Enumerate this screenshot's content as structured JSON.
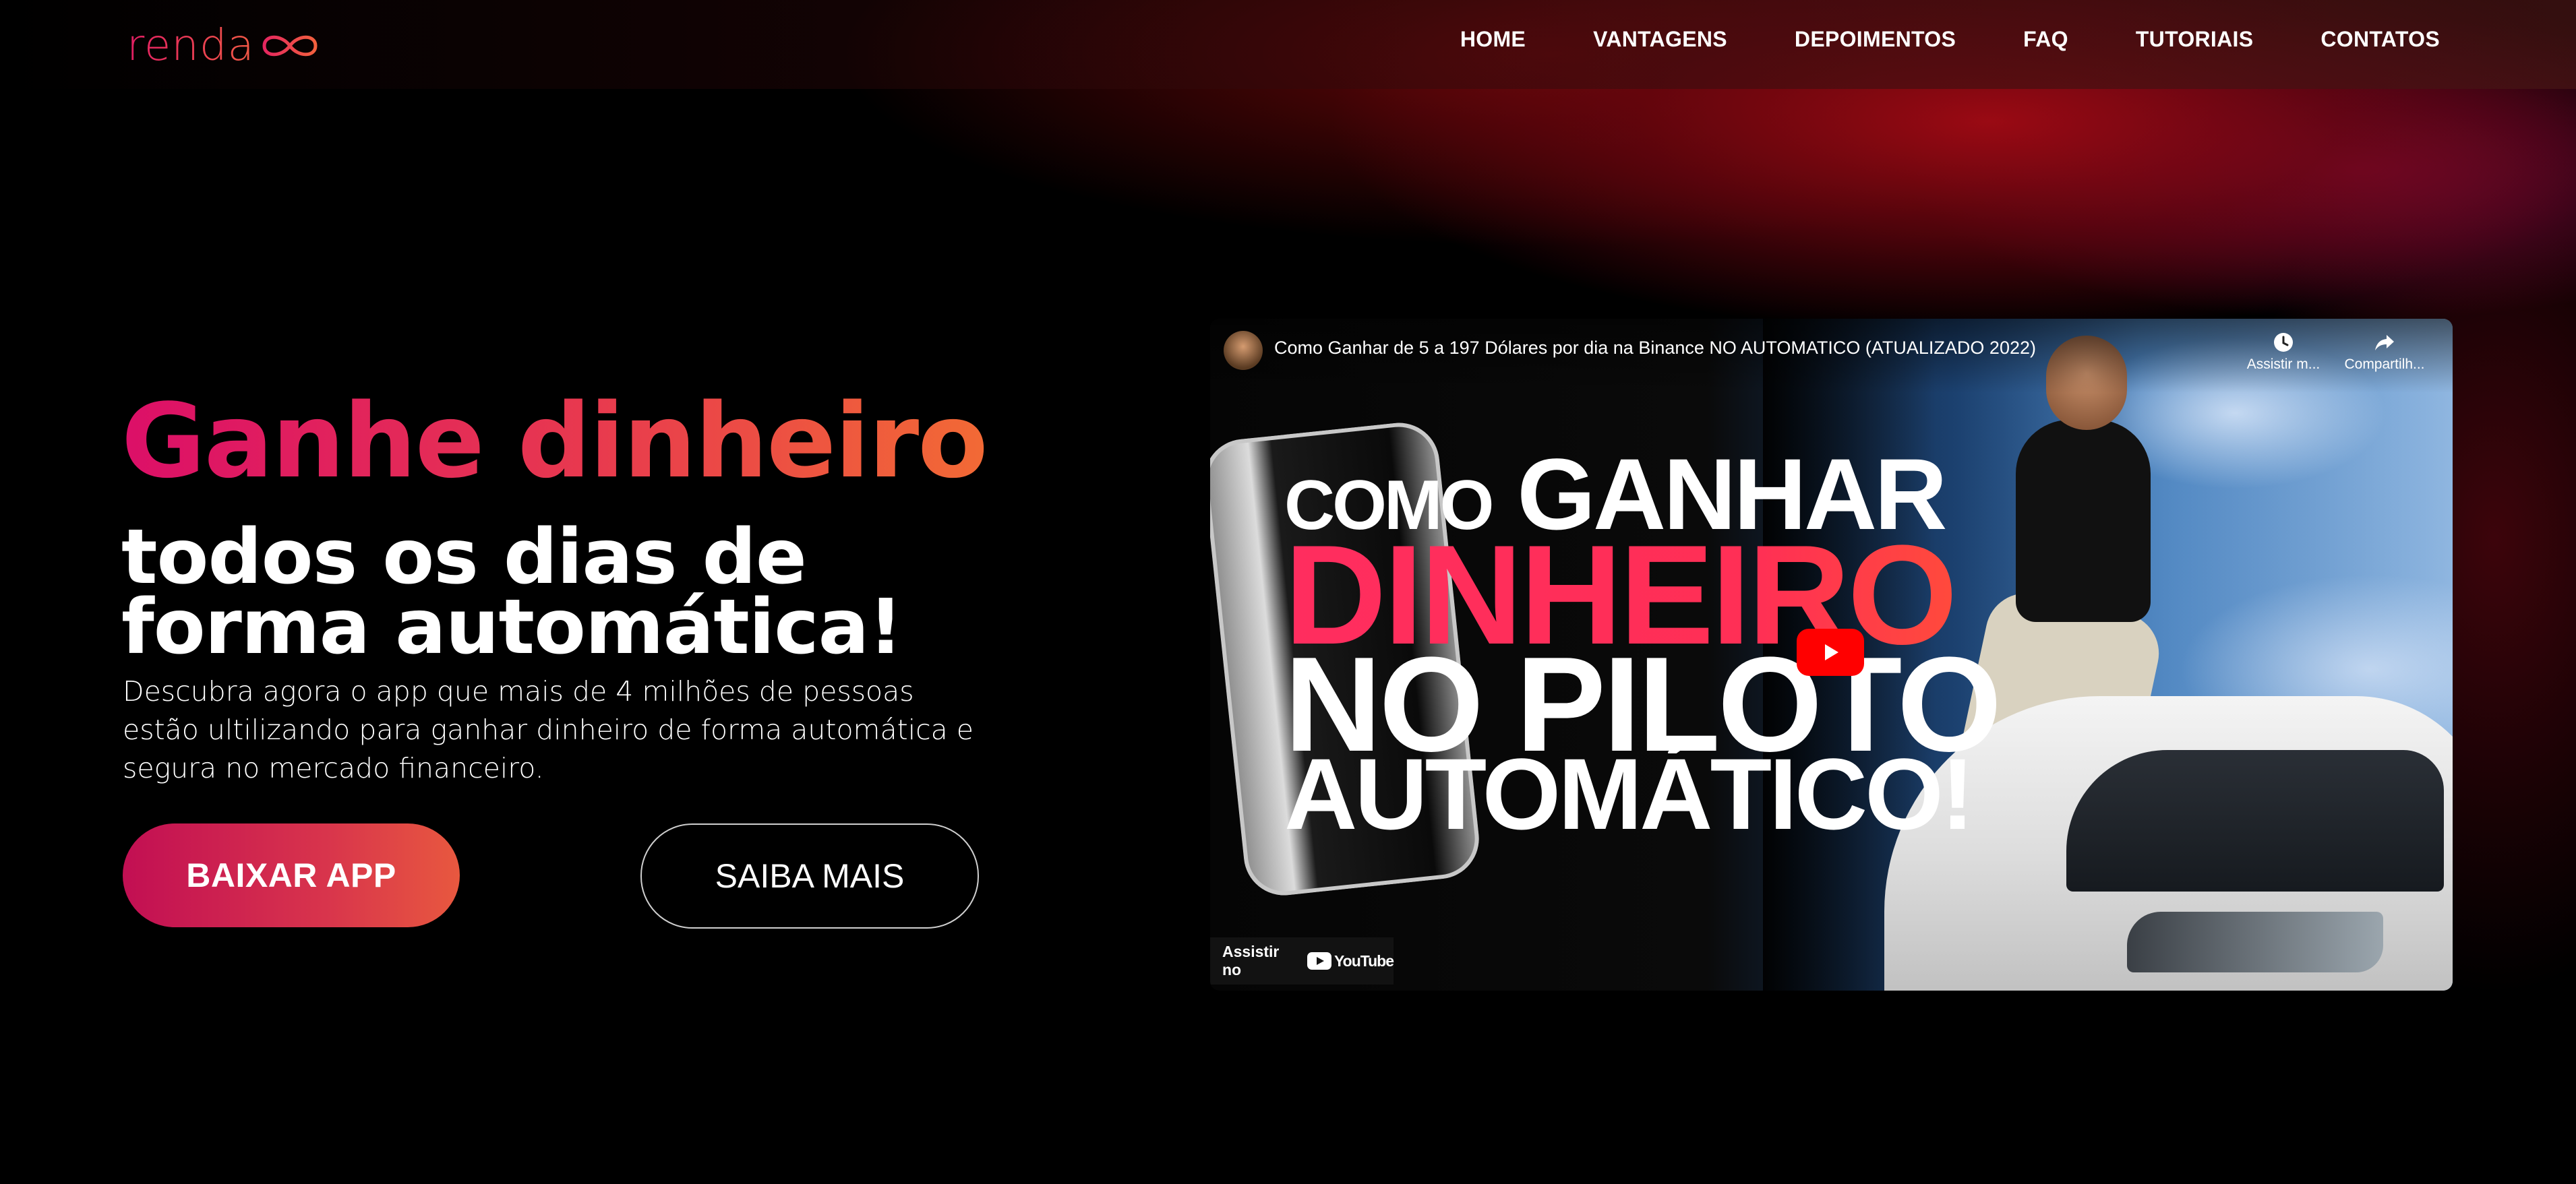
{
  "brand": {
    "logo_text": "renda",
    "logo_color": "#e62e5c"
  },
  "nav": {
    "items": [
      {
        "label": "HOME"
      },
      {
        "label": "VANTAGENS"
      },
      {
        "label": "DEPOIMENTOS"
      },
      {
        "label": "FAQ"
      },
      {
        "label": "TUTORIAIS"
      },
      {
        "label": "CONTATOS"
      }
    ]
  },
  "hero": {
    "title_highlight": "Ganhe dinheiro",
    "title_rest": "todos os dias de forma automática!",
    "description": "Descubra agora o app que mais de 4 milhões de pessoas estão ultilizando para ganhar dinheiro de forma automática e segura no mercado financeiro.",
    "primary_button": "BAIXAR APP",
    "secondary_button": "SAIBA MAIS",
    "accent_start": "#dc0f68",
    "accent_end": "#f26a35"
  },
  "video": {
    "title": "Como Ganhar de 5 a 197 Dólares por dia na Binance NO AUTOMATICO (ATUALIZADO 2022)",
    "thumb_line1_small": "COMO",
    "thumb_line1_big": "GANHAR",
    "thumb_line2": "DINHEIRO",
    "thumb_line3": "NO PILOTO",
    "thumb_line4": "AUTOMÁTICO!",
    "watch_later_label": "Assistir m...",
    "share_label": "Compartilh...",
    "watch_on_label": "Assistir no",
    "youtube_label": "YouTube",
    "icons": [
      "clock-icon",
      "share-icon",
      "play-icon",
      "youtube-logo-icon"
    ]
  }
}
